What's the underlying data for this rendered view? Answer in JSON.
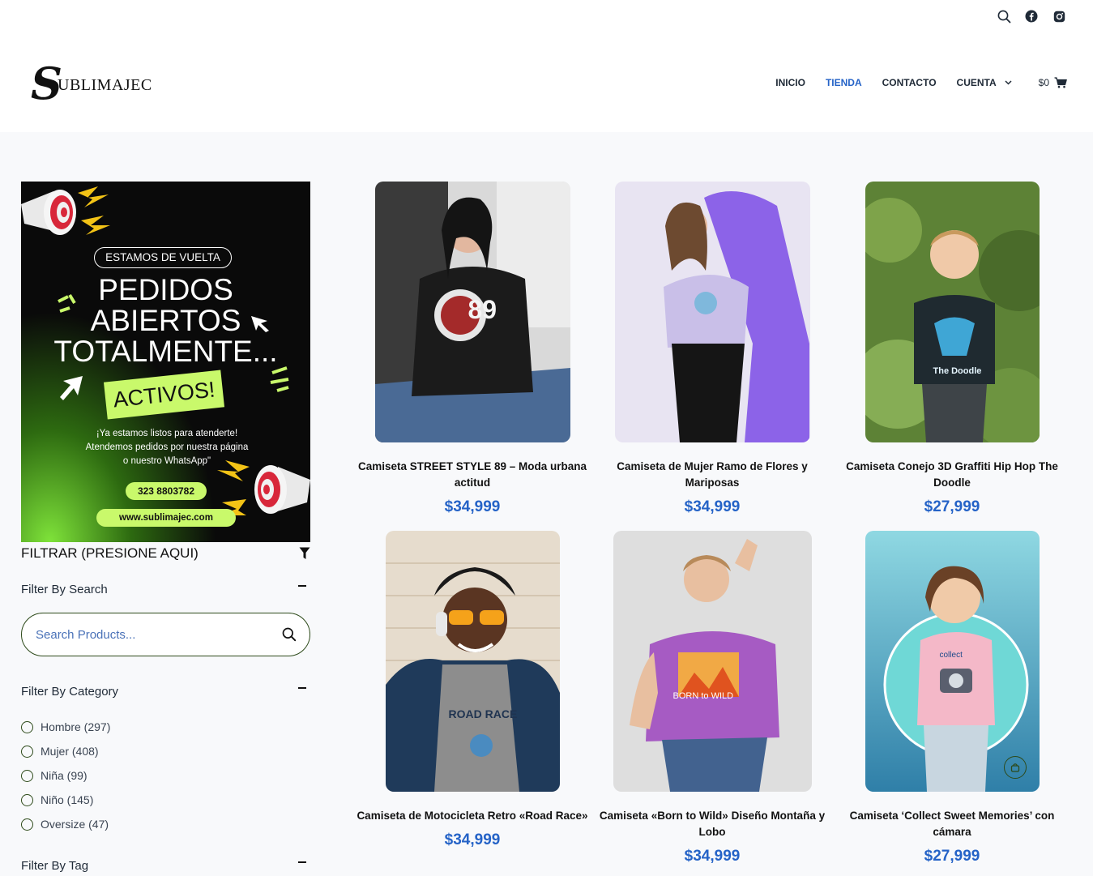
{
  "header": {
    "logo_initial": "S",
    "logo_rest": "UBLIMAJEC",
    "nav": [
      {
        "label": "INICIO"
      },
      {
        "label": "TIENDA"
      },
      {
        "label": "CONTACTO"
      },
      {
        "label": "CUENTA"
      }
    ],
    "cart_total": "$0",
    "icons": [
      "search-icon",
      "facebook-icon",
      "instagram-icon"
    ],
    "active_color": "#2563c7"
  },
  "banner": {
    "pill": "ESTAMOS DE VUELTA",
    "line1": "PEDIDOS",
    "line2": "ABIERTOS",
    "line3": "TOTALMENTE...",
    "tag": "ACTIVOS!",
    "desc1": "¡Ya estamos listos para atenderte!",
    "desc2": "Atendemos pedidos por nuestra página",
    "desc3": "o nuestro WhatsApp\"",
    "phone": "323 8803782",
    "website": "www.sublimajec.com"
  },
  "filters": {
    "title": "FILTRAR (PRESIONE AQUI)",
    "search_heading": "Filter By Search",
    "search_placeholder": "Search Products...",
    "category_heading": "Filter By Category",
    "categories": [
      {
        "label": "Hombre (297)"
      },
      {
        "label": "Mujer (408)"
      },
      {
        "label": "Niña (99)"
      },
      {
        "label": "Niño (145)"
      },
      {
        "label": "Oversize (47)"
      }
    ],
    "tag_heading": "Filter By Tag"
  },
  "products": [
    {
      "title": "Camiseta STREET STYLE 89 – Moda urbana actitud",
      "price": "$34,999",
      "print": "89"
    },
    {
      "title": "Camiseta de Mujer Ramo de Flores y Mariposas",
      "price": "$34,999"
    },
    {
      "title": "Camiseta Conejo 3D Graffiti Hip Hop The Doodle",
      "price": "$27,999",
      "print": "The Doodle"
    },
    {
      "title": "Camiseta de Motocicleta Retro «Road Race»",
      "price": "$34,999",
      "print": "ROAD RACE"
    },
    {
      "title": "Camiseta «Born to Wild» Diseño Montaña y Lobo",
      "price": "$34,999",
      "print": "BORN to WILD"
    },
    {
      "title": "Camiseta ‘Collect Sweet Memories’ con cámara",
      "price": "$27,999",
      "print": "collect"
    }
  ]
}
